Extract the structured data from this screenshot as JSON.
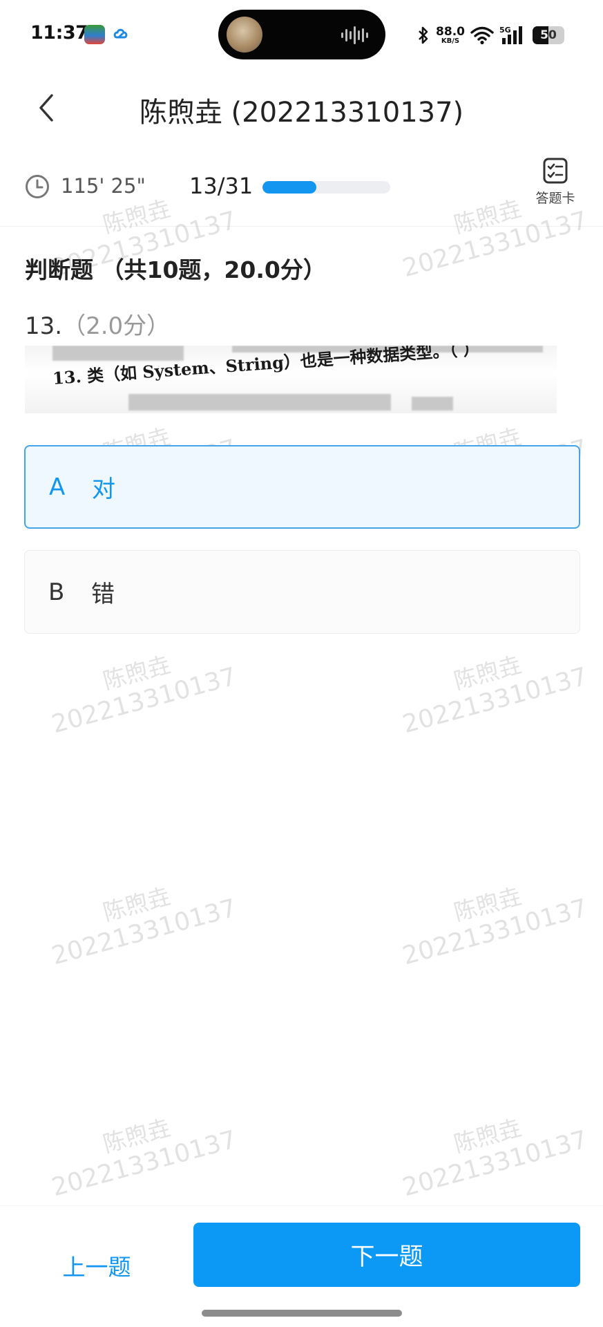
{
  "status_bar": {
    "time": "11:37",
    "network_speed": "88.0",
    "network_unit": "KB/S",
    "network_type": "5G",
    "battery": "50",
    "battery_level": 0.5,
    "icons": [
      "app-icon",
      "cloud-icon",
      "bluetooth-icon",
      "wifi-icon",
      "signal-icon",
      "battery-icon"
    ]
  },
  "header": {
    "title": "陈煦垚 (202213310137)"
  },
  "info_bar": {
    "timer": "115' 25\"",
    "progress_text": "13/31",
    "progress_fraction": 0.42,
    "answer_card_label": "答题卡"
  },
  "question": {
    "section_title": "判断题 （共10题，20.0分）",
    "number": "13.",
    "score": "（2.0分）",
    "image_text": "13. 类（如 System、String）也是一种数据类型。（  ）"
  },
  "options": [
    {
      "letter": "A",
      "text": "对",
      "selected": true
    },
    {
      "letter": "B",
      "text": "错",
      "selected": false
    }
  ],
  "watermark": {
    "name": "陈煦垚",
    "id": "202213310137"
  },
  "bottom": {
    "prev_label": "上一题",
    "next_label": "下一题"
  },
  "colors": {
    "accent": "#1296f0",
    "selected_bg": "#eef8fe",
    "selected_border": "#43a5e8"
  }
}
